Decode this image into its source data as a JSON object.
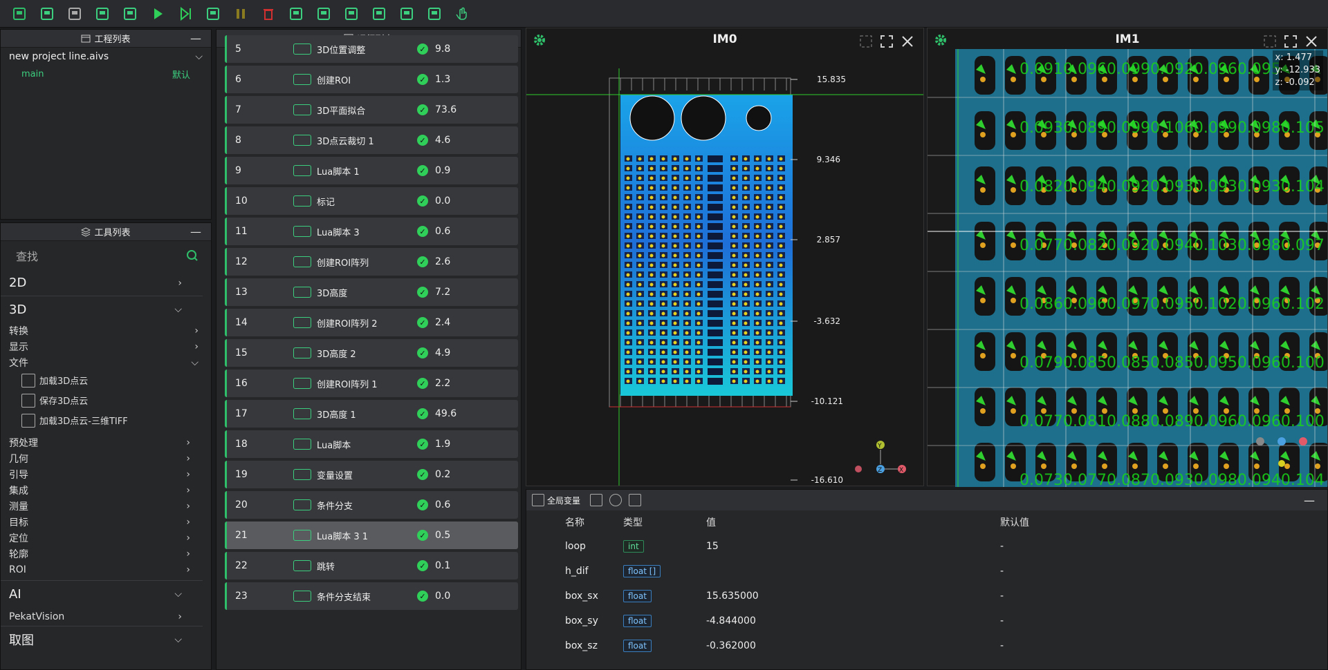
{
  "toolbar": {
    "icons": [
      "new-project-icon",
      "open-3d-icon",
      "open-file-icon",
      "save-icon",
      "save-as-icon",
      "run-icon",
      "step-run-icon",
      "loop-run-icon",
      "pause-icon",
      "delete-icon",
      "image-icon",
      "image-edit-icon",
      "layout-icon",
      "copy-icon",
      "refresh-icon",
      "grid-layout-icon",
      "hand-icon"
    ]
  },
  "project_panel": {
    "title": "工程列表",
    "file": "new project line.aivs",
    "main": "main",
    "main_tag": "默认"
  },
  "tools_panel": {
    "title": "工具列表",
    "search_placeholder": "查找",
    "cat_2d": "2D",
    "cat_3d": "3D",
    "sub3d": [
      "转换",
      "显示",
      "文件"
    ],
    "file_items": [
      "加载3D点云",
      "保存3D点云",
      "加载3D点云-三维TIFF"
    ],
    "sub3d_more": [
      "预处理",
      "几何",
      "引导",
      "集成",
      "测量",
      "目标",
      "定位",
      "轮廓",
      "ROI"
    ],
    "cat_ai": "AI",
    "pekat": "PekatVision",
    "cat_grab": "取图"
  },
  "run_panel": {
    "title": "运行列表",
    "rows": [
      {
        "num": "5",
        "name": "3D位置调整",
        "time": "9.8"
      },
      {
        "num": "6",
        "name": "创建ROI",
        "time": "1.3"
      },
      {
        "num": "7",
        "name": "3D平面拟合",
        "time": "73.6"
      },
      {
        "num": "8",
        "name": "3D点云裁切 1",
        "time": "4.6"
      },
      {
        "num": "9",
        "name": "Lua脚本 1",
        "time": "0.9"
      },
      {
        "num": "10",
        "name": "标记",
        "time": "0.0"
      },
      {
        "num": "11",
        "name": "Lua脚本 3",
        "time": "0.6"
      },
      {
        "num": "12",
        "name": "创建ROI阵列",
        "time": "2.6"
      },
      {
        "num": "13",
        "name": "3D高度",
        "time": "7.2"
      },
      {
        "num": "14",
        "name": "创建ROI阵列 2",
        "time": "2.4"
      },
      {
        "num": "15",
        "name": "3D高度 2",
        "time": "4.9"
      },
      {
        "num": "16",
        "name": "创建ROI阵列 1",
        "time": "2.2"
      },
      {
        "num": "17",
        "name": "3D高度 1",
        "time": "49.6"
      },
      {
        "num": "18",
        "name": "Lua脚本",
        "time": "1.9"
      },
      {
        "num": "19",
        "name": "变量设置",
        "time": "0.2"
      },
      {
        "num": "20",
        "name": "条件分支",
        "time": "0.6"
      },
      {
        "num": "21",
        "name": "Lua脚本 3 1",
        "time": "0.5"
      },
      {
        "num": "22",
        "name": "跳转",
        "time": "0.1"
      },
      {
        "num": "23",
        "name": "条件分支结束",
        "time": "0.0"
      }
    ]
  },
  "im0": {
    "title": "IM0",
    "axis_labels": [
      "15.835",
      "9.346",
      "2.857",
      "-3.632",
      "-10.121",
      "-16.610"
    ],
    "gizmo": {
      "y": "Y",
      "z": "Z",
      "x": "X"
    }
  },
  "im1": {
    "title": "IM1",
    "coord_x": "x: 1.477",
    "coord_y": "y: -12.933",
    "coord_z": "z: -0.092",
    "overlay": [
      "0.0910.0960.0990.0920.0960.095",
      "0.0930.0890.0990.1060.0990.0980.105",
      "0.0820.0940.0920.0930.0930.0930.104",
      "0.0770.0820.0920.0940.1030.0980.097",
      "0.0860.0960.0970.0950.1020.0960.102",
      "0.0790.0850.0850.0850.0950.0960.100",
      "0.0770.0810.0880.0890.0960.0960.100",
      "0.0730.0770.0870.0930.0980.0940.104"
    ]
  },
  "vars_panel": {
    "tab": "全局变量",
    "cols": [
      "名称",
      "类型",
      "值",
      "默认值"
    ],
    "rows": [
      {
        "name": "loop",
        "type": "int",
        "value": "15",
        "default": "-"
      },
      {
        "name": "h_dif",
        "type": "float []",
        "value": "",
        "default": "-"
      },
      {
        "name": "box_sx",
        "type": "float",
        "value": "15.635000",
        "default": "-"
      },
      {
        "name": "box_sy",
        "type": "float",
        "value": "-4.844000",
        "default": "-"
      },
      {
        "name": "box_sz",
        "type": "float",
        "value": "-0.362000",
        "default": "-"
      }
    ]
  }
}
